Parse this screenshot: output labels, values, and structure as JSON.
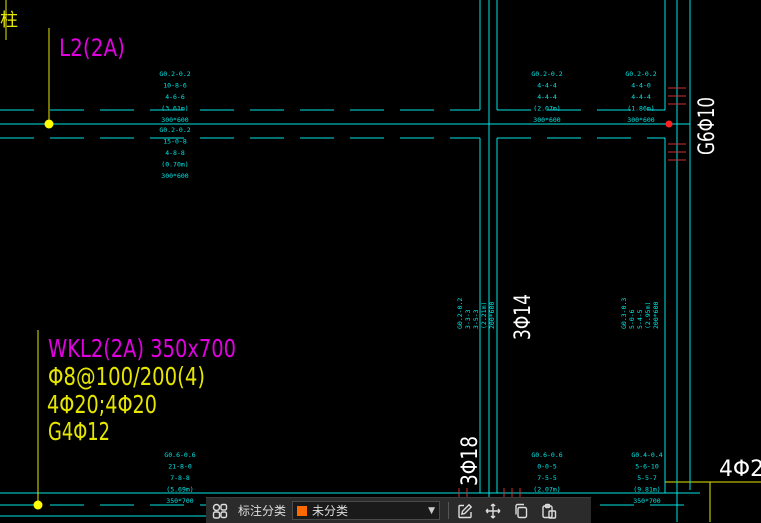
{
  "colors": {
    "background": "#000000",
    "axis_line": "#00e5e5",
    "beam_label": "#e000e0",
    "rebar_label": "#e6e600",
    "white_text": "#ffffff",
    "toolbar_bg": "#2b2b2b",
    "category_swatch": "#ff6a00"
  },
  "drawing": {
    "top_left_fragment": "柱",
    "beam_l2_label": "L2(2A)",
    "beam_wkl2": {
      "name": "WKL2(2A) 350x700",
      "stirrup": "Φ8@100/200(4)",
      "main_bars": "4Φ20;4Φ20",
      "side_bars": "G4Φ12"
    },
    "right_vertical_label": "G6Φ10",
    "vertical_mid_label": "3Φ14",
    "vertical_bottom_label": "3Φ18",
    "bottom_right_label": "4Φ2",
    "small_annotations": {
      "a1": [
        "G0.2-0.2",
        "10-8-6",
        "4-6-6",
        "(3.61m)",
        "300*600"
      ],
      "a2": [
        "G0.2-0.2",
        "15-0-8",
        "4-8-8",
        "(0.70m)",
        "300*600"
      ],
      "a3": [
        "G0.2-0.2",
        "4-4-4",
        "4-4-4",
        "(2.07m)",
        "300*600"
      ],
      "a4": [
        "G0.2-0.2",
        "4-4-0",
        "4-4-4",
        "(1.86m)",
        "300*600"
      ],
      "v1": [
        "G0.2-0.2",
        "3-3-3",
        "3-5-3",
        "(2.21m)",
        "200*600"
      ],
      "v2": [
        "G0.3-0.3",
        "5-0-6",
        "5-4-5",
        "(2.95m)",
        "200*600"
      ],
      "b1": [
        "G0.6-0.6",
        "21-8-0",
        "7-8-8",
        "(5.69m)",
        "350*700"
      ],
      "b2": [
        "G0.6-0.6",
        "0-0-5",
        "7-5-5",
        "(2.07m)"
      ],
      "b3": [
        "G0.4-0.4",
        "5-6-10",
        "5-5-7",
        "(9.81m)",
        "350*700"
      ]
    }
  },
  "toolbar": {
    "icon_grid": "grid-icon",
    "label": "标注分类",
    "category_value": "未分类",
    "icon_edit": "edit-icon",
    "icon_move": "move-icon",
    "icon_copy": "copy-icon",
    "icon_paste": "paste-icon"
  }
}
